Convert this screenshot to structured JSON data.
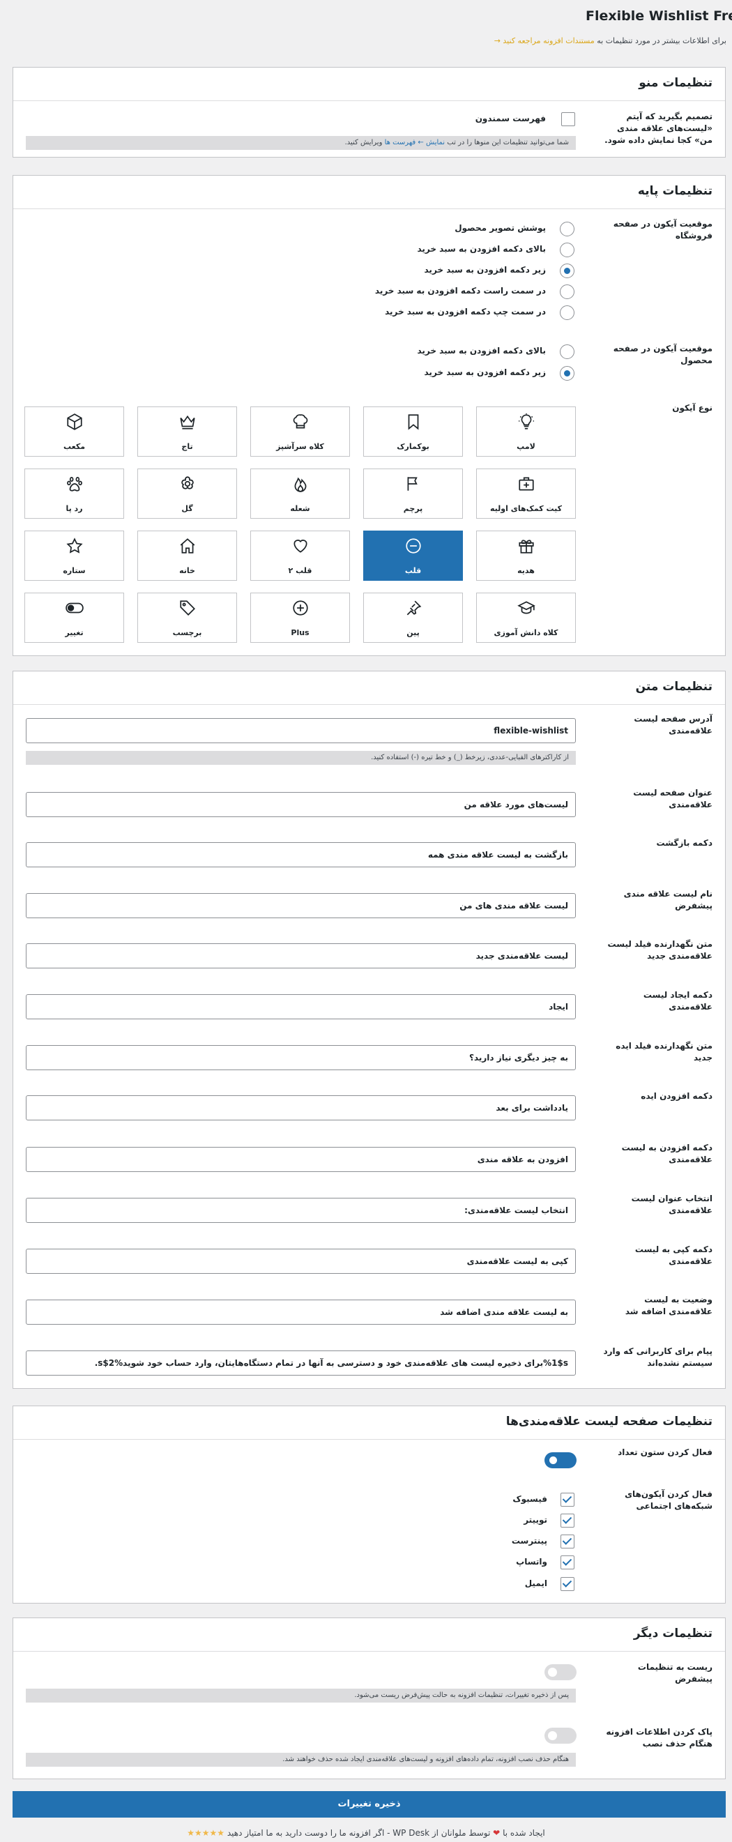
{
  "header": {
    "title": "Flexible Wishlist Free",
    "subtitle_text": "برای اطلاعات بیشتر در مورد تنظیمات به",
    "subtitle_link": "مستندات افزونه مراجعه کنید →"
  },
  "menu_settings": {
    "title": "تنظیمات منو",
    "label": "تصمیم بگیرید که آیتم «لیست‌های علاقه مندی من» کجا نمایش داده شود.",
    "option": "فهرست سمندون",
    "notice_pre": "شما می‌توانید تنظیمات این منوها را در تب",
    "notice_link": "نمایش ← فهرست ها",
    "notice_post": "ویرایش کنید."
  },
  "basic_settings": {
    "title": "تنظیمات پایه",
    "shop_label": "موقعیت آیکون در صفحه فروشگاه",
    "shop_options": [
      {
        "label": "پوشش تصویر محصول",
        "checked": false
      },
      {
        "label": "بالای دکمه افزودن به سبد خرید",
        "checked": false
      },
      {
        "label": "زیر دکمه افزودن به سبد خرید",
        "checked": true
      },
      {
        "label": "در سمت راست دکمه افزودن به سبد خرید",
        "checked": false
      },
      {
        "label": "در سمت چپ دکمه افزودن به سبد خرید",
        "checked": false
      }
    ],
    "product_label": "موقعیت آیکون در صفحه محصول",
    "product_options": [
      {
        "label": "بالای دکمه افزودن به سبد خرید",
        "checked": false
      },
      {
        "label": "زیر دکمه افزودن به سبد خرید",
        "checked": true
      }
    ],
    "icon_label": "نوع آیکون",
    "icons": [
      {
        "label": "لامپ",
        "icon": "bulb-icon"
      },
      {
        "label": "بوکمارک",
        "icon": "bookmark-icon"
      },
      {
        "label": "کلاه سرآشپز",
        "icon": "chef-hat-icon"
      },
      {
        "label": "تاج",
        "icon": "crown-icon"
      },
      {
        "label": "مکعب",
        "icon": "cube-icon"
      },
      {
        "label": "کیت کمک‌های اولیه",
        "icon": "first-aid-kit-icon"
      },
      {
        "label": "پرچم",
        "icon": "flag-icon"
      },
      {
        "label": "شعله",
        "icon": "flame-icon"
      },
      {
        "label": "گل",
        "icon": "flower-icon"
      },
      {
        "label": "رد پا",
        "icon": "paw-icon"
      },
      {
        "label": "هدیه",
        "icon": "gift-icon"
      },
      {
        "label": "قلب",
        "icon": "heart-minus-icon",
        "selected": true
      },
      {
        "label": "قلب ۲",
        "icon": "heart-icon"
      },
      {
        "label": "خانه",
        "icon": "home-icon"
      },
      {
        "label": "ستاره",
        "icon": "star-icon"
      },
      {
        "label": "کلاه دانش آموزی",
        "icon": "graduation-cap-icon"
      },
      {
        "label": "پین",
        "icon": "pin-icon"
      },
      {
        "label": "Plus",
        "icon": "plus-icon"
      },
      {
        "label": "برچسب",
        "icon": "tag-icon"
      },
      {
        "label": "تغییر",
        "icon": "toggle-icon"
      }
    ]
  },
  "text_settings": {
    "title": "تنظیمات متن",
    "fields": [
      {
        "label": "آدرس صفحه لیست علاقه‌مندی",
        "value": "flexible-wishlist",
        "notice": "از کاراکترهای الفبایی-عددی، زیرخط (_) و خط تیره (-) استفاده کنید."
      },
      {
        "label": "عنوان صفحه لیست علاقه‌مندی",
        "value": "لیست‌های مورد علاقه من"
      },
      {
        "label": "دکمه بازگشت",
        "value": "بازگشت به لیست علاقه مندی همه"
      },
      {
        "label": "نام لیست علاقه مندی پیشفرض",
        "value": "لیست علاقه مندی های من"
      },
      {
        "label": "متن نگهدارنده فیلد لیست علاقه‌مندی جدید",
        "value": "لیست علاقه‌مندی جدید"
      },
      {
        "label": "دکمه ایجاد لیست علاقه‌مندی",
        "value": "ایجاد"
      },
      {
        "label": "متن نگهدارنده فیلد ایده جدید",
        "value": "به چیز دیگری نیاز دارید؟"
      },
      {
        "label": "دکمه افزودن ایده",
        "value": "یادداشت برای بعد"
      },
      {
        "label": "دکمه افزودن به لیست علاقه‌مندی",
        "value": "افزودن به علاقه مندی"
      },
      {
        "label": "انتخاب عنوان لیست علاقه‌مندی",
        "value": "انتخاب لیست علاقه‌مندی:"
      },
      {
        "label": "دکمه کپی به لیست علاقه‌مندی",
        "value": "کپی به لیست علاقه‌مندی"
      },
      {
        "label": "وضعیت به لیست علاقه‌مندی اضافه شد",
        "value": "به لیست علاقه مندی اضافه شد"
      },
      {
        "label": "پیام برای کاربرانی که وارد سیستم نشده‌اند",
        "value": "%1$sبرای ذخیره لیست های علاقه‌مندی خود و دسترسی به آنها در تمام دستگاه‌هایتان، وارد حساب خود شوید%2$s."
      }
    ]
  },
  "wishlist_page_settings": {
    "title": "تنظیمات صفحه لیست علاقه‌مندی‌ها",
    "quantity_label": "فعال کردن ستون تعداد",
    "quantity_on": true,
    "social_label": "فعال کردن آیکون‌های شبکه‌های اجتماعی",
    "social_options": [
      {
        "label": "فیسبوک",
        "checked": true
      },
      {
        "label": "توییتر",
        "checked": true
      },
      {
        "label": "پینترست",
        "checked": true
      },
      {
        "label": "واتساپ",
        "checked": true
      },
      {
        "label": "ایمیل",
        "checked": true
      }
    ]
  },
  "other_settings": {
    "title": "تنظیمات دیگر",
    "reset_label": "ریست به تنظیمات پیشفرض",
    "reset_notice": "پس از ذخیره تغییرات، تنظیمات افزونه به حالت پیش‌فرض ریست می‌شود.",
    "clean_label": "پاک کردن اطلاعات افزونه هنگام حذف نصب",
    "clean_notice": "هنگام حذف نصب افزونه، تمام داده‌های افزونه و لیست‌های علاقه‌مندی ایجاد شده حذف خواهند شد."
  },
  "save_button": "ذخیره تغییرات",
  "footer": {
    "pre": "ایجاد شده با",
    "heart": "❤",
    "post": "توسط ملوانان از WP Desk - اگر افزونه ما را دوست دارید به ما امتیاز دهید",
    "stars": "★★★★★"
  }
}
